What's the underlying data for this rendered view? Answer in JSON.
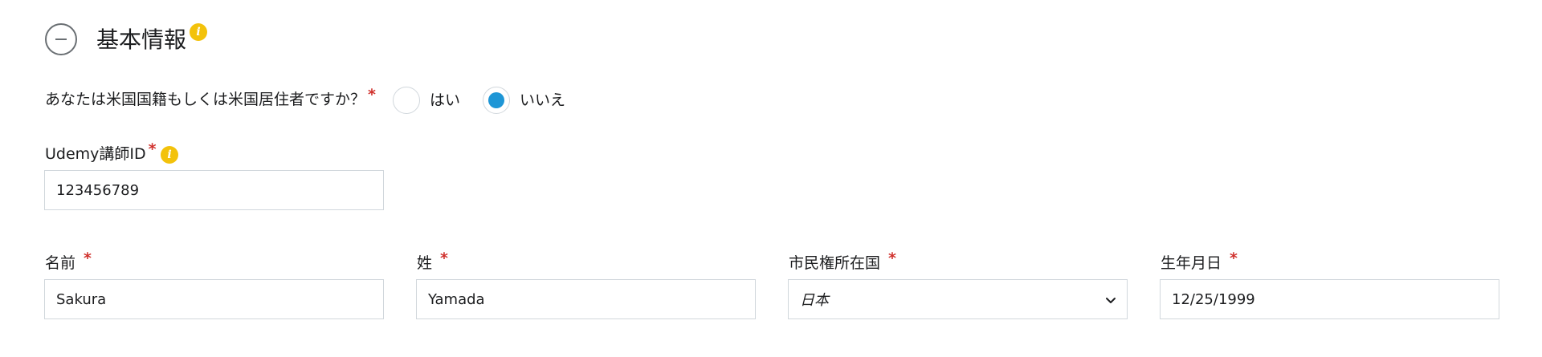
{
  "section": {
    "title": "基本情報"
  },
  "question": {
    "text": "あなたは米国国籍もしくは米国居住者ですか？",
    "required_mark": "*",
    "options": [
      {
        "label": "はい",
        "selected": false
      },
      {
        "label": "いいえ",
        "selected": true
      }
    ]
  },
  "instructor_id": {
    "label": "Udemy講師ID",
    "required_mark": "*",
    "value": "123456789"
  },
  "fields": {
    "first_name": {
      "label": "名前",
      "required_mark": "*",
      "value": "Sakura"
    },
    "last_name": {
      "label": "姓",
      "required_mark": "*",
      "value": "Yamada"
    },
    "country": {
      "label": "市民権所在国",
      "required_mark": "*",
      "value": "日本"
    },
    "birthdate": {
      "label": "生年月日",
      "required_mark": "*",
      "value": "12/25/1999"
    }
  },
  "colors": {
    "accent": "#1e96d6",
    "required": "#d0312d",
    "info": "#f3c20b",
    "border": "#d1d7dc"
  },
  "icons": {
    "collapse": "minus-circle-icon",
    "info": "info-icon",
    "select": "chevron-down-icon"
  }
}
